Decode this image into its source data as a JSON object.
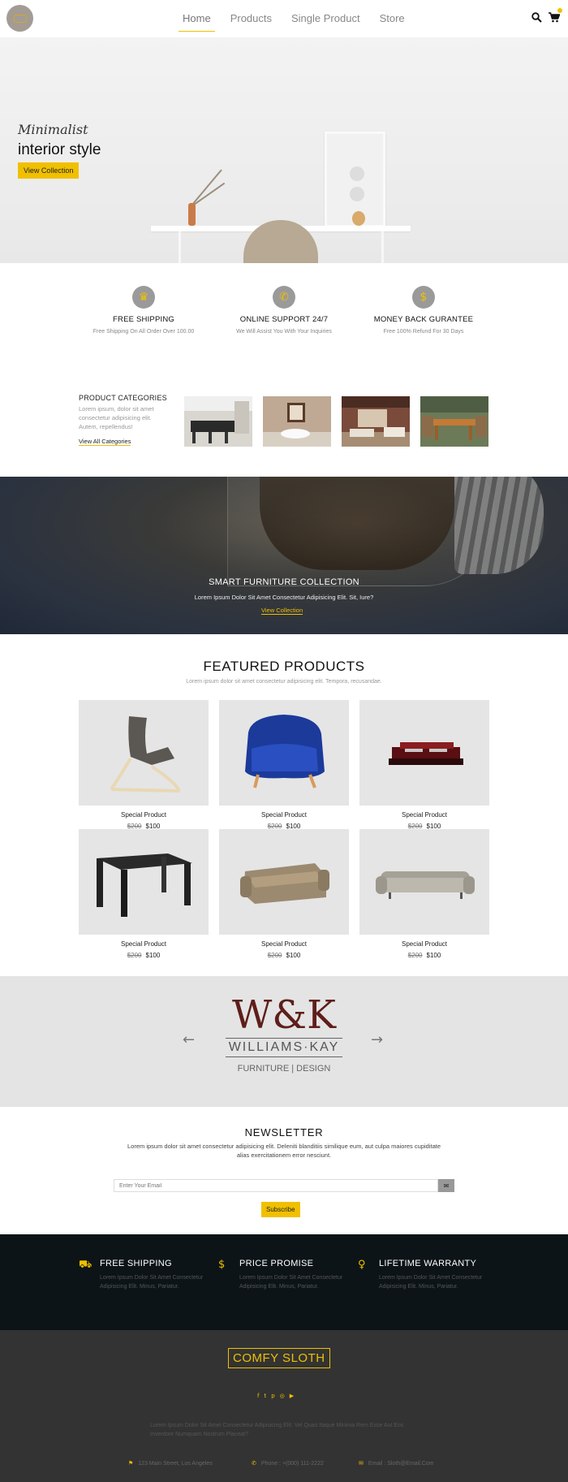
{
  "nav": {
    "logo": "Comfy Sloth logo",
    "links": [
      "Home",
      "Products",
      "Single Product",
      "Store"
    ],
    "active": "Home",
    "icons": [
      "search-icon",
      "cart-icon"
    ]
  },
  "hero": {
    "kicker": "Minimalist",
    "title": "interior style",
    "cta": "View Collection"
  },
  "features": [
    {
      "icon": "trophy-icon",
      "title": "FREE SHIPPING",
      "subtitle": "Free Shipping On All Order Over 100.00"
    },
    {
      "icon": "phone-icon",
      "title": "ONLINE SUPPORT 24/7",
      "subtitle": "We Will Assist You With Your Inquiries"
    },
    {
      "icon": "dollar-icon",
      "title": "MONEY BACK GURANTEE",
      "subtitle": "Free 100% Refund For 30 Days"
    }
  ],
  "categories": {
    "heading": "PRODUCT CATEGORIES",
    "text": "Lorem ipsum, dolor sit amet consectetur adipisicing elit. Autem, repellendus!",
    "link": "View All Categories"
  },
  "banner": {
    "title": "SMART FURNITURE COLLECTION",
    "subtitle": "Lorem Ipsum Dolor Sit Amet Consectetur Adipisicing Elit. Sit, Iure?",
    "link": "View Collection"
  },
  "featured": {
    "title": "FEATURED PRODUCTS",
    "subtitle": "Lorem ipsum dolor sit amet consectetur adipisicing elit. Tempora, recusandae.",
    "products": [
      {
        "name": "Special Product",
        "old_price": "$200",
        "price": "$100"
      },
      {
        "name": "Special Product",
        "old_price": "$200",
        "price": "$100"
      },
      {
        "name": "Special Product",
        "old_price": "$200",
        "price": "$100"
      },
      {
        "name": "Special Product",
        "old_price": "$200",
        "price": "$100"
      },
      {
        "name": "Special Product",
        "old_price": "$200",
        "price": "$100"
      },
      {
        "name": "Special Product",
        "old_price": "$200",
        "price": "$100"
      }
    ]
  },
  "brand": {
    "monogram": "W&K",
    "name": "WILLIAMS·KAY",
    "tagline": "FURNITURE | DESIGN",
    "prev": "←",
    "next": "→"
  },
  "newsletter": {
    "title": "NEWSLETTER",
    "text": "Lorem ipsum dolor sit amet consectetur adipisicing elit. Deleniti blanditiis similique eum, aut culpa maiores cupiditate alias exercitationem error nesciunt.",
    "placeholder": "Enter Your Email",
    "button": "Subscribe"
  },
  "perks": [
    {
      "icon": "truck-icon",
      "title": "FREE SHIPPING",
      "text": "Lorem Ipsum Dolor Sit Amet Consectetur Adipisicing Elit. Minus, Pariatur."
    },
    {
      "icon": "price-tag-icon",
      "title": "PRICE PROMISE",
      "text": "Lorem Ipsum Dolor Sit Amet Consectetur Adipisicing Elit. Minus, Pariatur."
    },
    {
      "icon": "medal-icon",
      "title": "LIFETIME WARRANTY",
      "text": "Lorem Ipsum Dolor Sit Amet Consectetur Adipisicing Elit. Minus, Pariatur."
    }
  ],
  "footer": {
    "logo": "COMFY SLOTH",
    "socials": [
      "facebook-icon",
      "twitter-icon",
      "pinterest-icon",
      "instagram-icon",
      "youtube-icon"
    ],
    "text": "Lorem Ipsum Dolor Sit Amet Consectetur Adipisicing Elit. Vel Quas Itaque Minima Rem Esse Aut Eos Inventore Numquam Nostrum Placeat?",
    "address": "123 Main Street, Los Angeles",
    "phone": "Phone : +(000) 111-2222",
    "email": "Email : Sloth@Email.Com"
  },
  "colors": {
    "accent": "#f0c000",
    "dark": "#0c1418",
    "footer": "#333333"
  }
}
